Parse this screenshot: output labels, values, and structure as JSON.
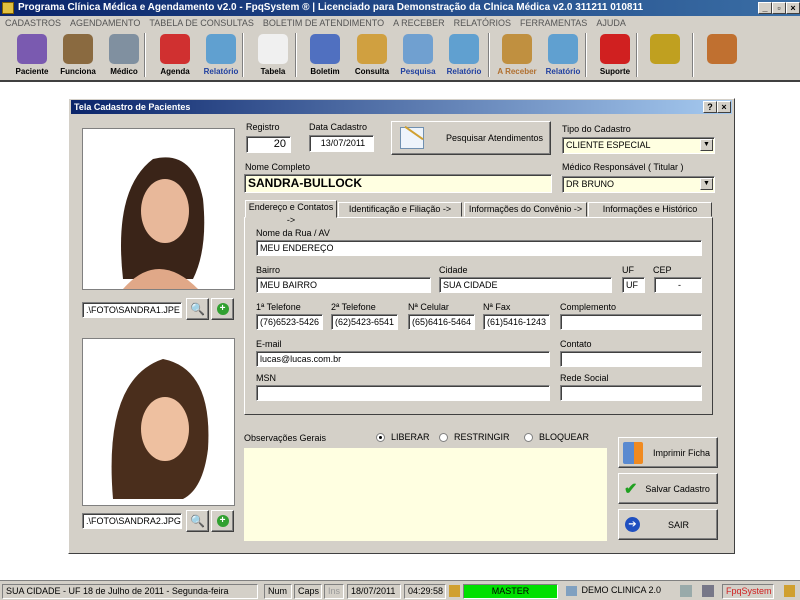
{
  "window": {
    "title": "Programa Clínica Médica e Agendamento v2.0 - FpqSystem ® | Licenciado para  Demonstração da Clnica Médica v2.0 311211 010811"
  },
  "menu": [
    "CADASTROS",
    "AGENDAMENTO",
    "TABELA DE CONSULTAS",
    "BOLETIM DE ATENDIMENTO",
    "A RECEBER",
    "RELATÓRIOS",
    "FERRAMENTAS",
    "AJUDA"
  ],
  "toolbar": [
    {
      "label": "Paciente",
      "icon": "patients-icon",
      "color": "#7a5ab0"
    },
    {
      "label": "Funciona",
      "icon": "employees-icon",
      "color": "#8a6a40"
    },
    {
      "label": "Médico",
      "icon": "doctor-icon",
      "color": "#8090a0"
    },
    {
      "label": "Agenda",
      "icon": "calendar-icon",
      "color": "#d03030"
    },
    {
      "label": "Relatório",
      "icon": "report-icon",
      "color": "#60a0d0"
    },
    {
      "label": "Tabela",
      "icon": "table-doc-icon",
      "color": "#f0f0f0"
    },
    {
      "label": "Boletim",
      "icon": "bulletin-icon",
      "color": "#5070c0"
    },
    {
      "label": "Consulta",
      "icon": "file-box-icon",
      "color": "#d0a040"
    },
    {
      "label": "Pesquisa",
      "icon": "search-doc-icon",
      "color": "#70a0d0"
    },
    {
      "label": "Relatório",
      "icon": "report-icon",
      "color": "#60a0d0"
    },
    {
      "label": "A Receber",
      "icon": "money-bag-icon",
      "color": "#c09040"
    },
    {
      "label": "Relatório",
      "icon": "report-icon",
      "color": "#60a0d0"
    },
    {
      "label": "Suporte",
      "icon": "support-icon",
      "color": "#d02020"
    },
    {
      "label": "",
      "icon": "coin-icon",
      "color": "#c0a020"
    },
    {
      "label": "",
      "icon": "exit-door-icon",
      "color": "#c07030"
    }
  ],
  "dialog": {
    "title": "Tela Cadastro de Pacientes",
    "help": "?",
    "close": "×",
    "photo1_path": ".\\FOTO\\SANDRA1.JPE",
    "photo2_path": ".\\FOTO\\SANDRA2.JPG",
    "registro_label": "Registro",
    "registro": "20",
    "data_label": "Data Cadastro",
    "data": "13/07/2011",
    "pesquisar": "Pesquisar  Atendimentos",
    "tipo_label": "Tipo do Cadastro",
    "tipo": "CLIENTE ESPECIAL",
    "nome_label": "Nome Completo",
    "nome": "SANDRA-BULLOCK",
    "medico_label": "Médico Responsável ( Titular )",
    "medico": "DR BRUNO",
    "tabs": [
      "Endereço e Contatos ->",
      "Identificação e Filiação ->",
      "Informações do Convênio ->",
      "Informações e Histórico Clinico"
    ],
    "fields": {
      "rua_label": "Nome da Rua / AV",
      "rua": "MEU ENDEREÇO",
      "bairro_label": "Bairro",
      "bairro": "MEU BAIRRO",
      "cidade_label": "Cidade",
      "cidade": "SUA CIDADE",
      "uf_label": "UF",
      "uf": "UF",
      "cep_label": "CEP",
      "cep": "-",
      "tel1_label": "1ª Telefone",
      "tel1": "(76)6523-5426",
      "tel2_label": "2ª Telefone",
      "tel2": "(62)5423-6541",
      "cel_label": "Nª Celular",
      "cel": "(65)6416-5464",
      "fax_label": "Nª Fax",
      "fax": "(61)5416-1243",
      "compl_label": "Complemento",
      "compl": "",
      "email_label": "E-mail",
      "email": "lucas@lucas.com.br",
      "contato_label": "Contato",
      "contato": "",
      "msn_label": "MSN",
      "msn": "",
      "rede_label": "Rede Social",
      "rede": ""
    },
    "obs_label": "Observações Gerais",
    "radios": [
      "LIBERAR",
      "RESTRINGIR",
      "BLOQUEAR"
    ],
    "radio_selected": "LIBERAR",
    "obs": "",
    "imprimir": "Imprimir Ficha",
    "salvar": "Salvar Cadastro",
    "sair": "SAIR"
  },
  "status": {
    "location": "SUA CIDADE - UF 18 de Julho de 2011 - Segunda-feira",
    "num": "Num",
    "caps": "Caps",
    "ins": "Ins",
    "date": "18/07/2011",
    "time": "04:29:58",
    "user": "MASTER",
    "clinic": "DEMO CLINICA 2.0",
    "brand": "FpqSystem",
    "user_color": "#00e000"
  }
}
